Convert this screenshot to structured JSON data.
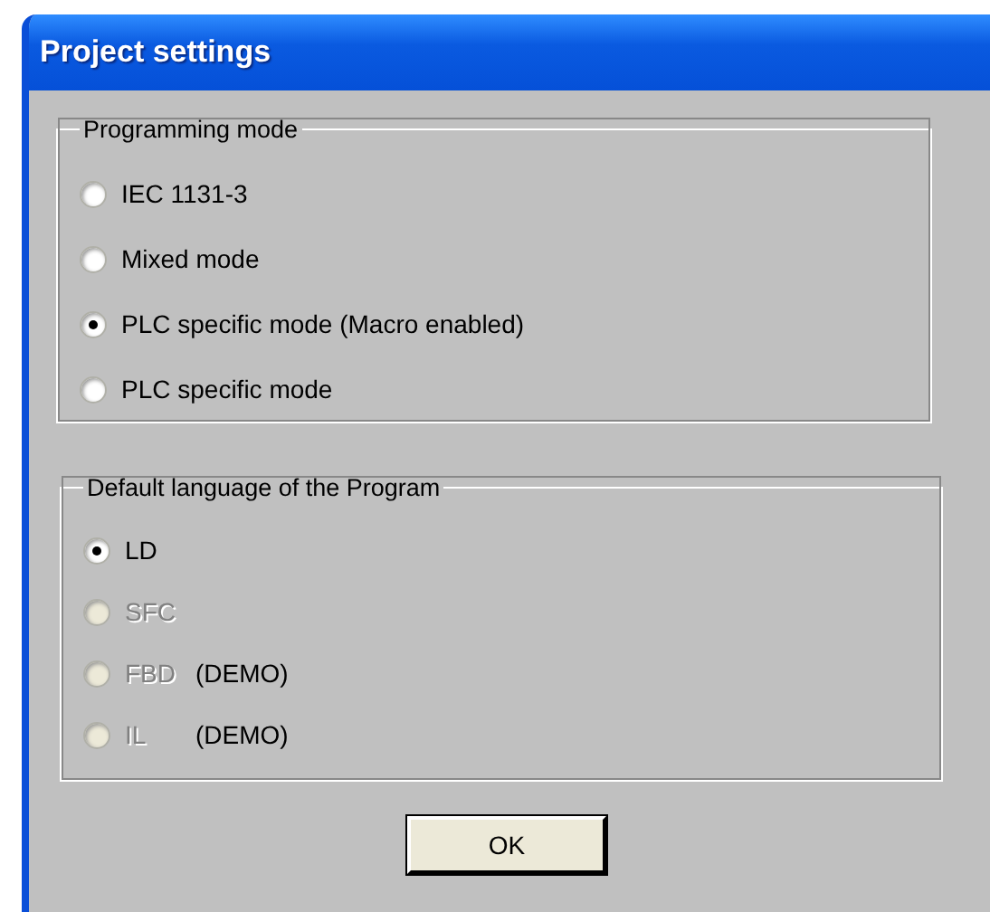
{
  "window": {
    "title": "Project settings"
  },
  "groups": [
    {
      "title": "Programming mode",
      "options": [
        {
          "label": "IEC 1131-3",
          "selected": false,
          "disabled": false
        },
        {
          "label": "Mixed mode",
          "selected": false,
          "disabled": false
        },
        {
          "label": "PLC specific mode (Macro enabled)",
          "selected": true,
          "disabled": false
        },
        {
          "label": "PLC specific mode",
          "selected": false,
          "disabled": false
        }
      ]
    },
    {
      "title": "Default language of the Program",
      "options": [
        {
          "label": "LD",
          "selected": true,
          "disabled": false
        },
        {
          "label": "SFC",
          "selected": false,
          "disabled": true
        },
        {
          "label": "FBD",
          "selected": false,
          "disabled": true,
          "note": "(DEMO)"
        },
        {
          "label": "IL",
          "selected": false,
          "disabled": true,
          "note": "(DEMO)"
        }
      ]
    }
  ],
  "buttons": [
    "OK"
  ]
}
